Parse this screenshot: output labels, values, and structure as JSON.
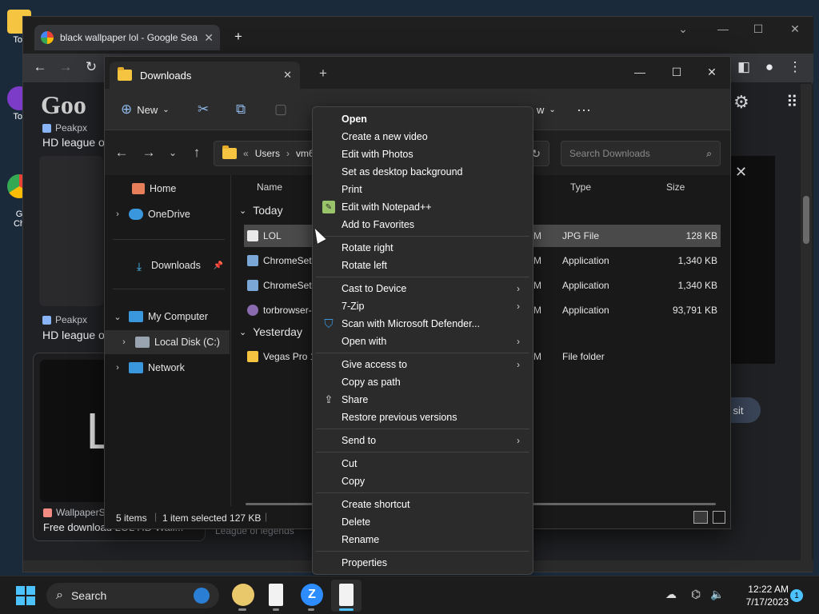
{
  "desktop": {
    "icons": [
      {
        "label": "Tor"
      },
      {
        "label": "Tor"
      },
      {
        "label": "G\nCh"
      }
    ]
  },
  "chrome": {
    "tab_title": "black wallpaper lol - Google Sear",
    "results": [
      {
        "source": "Peakpx",
        "title": "HD league o"
      },
      {
        "source": "Peakpx",
        "title": "HD league o"
      },
      {
        "source": "WallpaperS",
        "title": "Free download LOL HD Wall..."
      },
      {
        "source": "",
        "title": "League of legends"
      }
    ],
    "thumb_text": "LO",
    "visit_btn": "sit"
  },
  "explorer": {
    "tab_title": "Downloads",
    "commands": {
      "new_label": "New",
      "view_label": "w"
    },
    "address": {
      "prefix": "«",
      "parts": [
        "Users",
        "vm6"
      ]
    },
    "search": {
      "placeholder": "Search Downloads"
    },
    "nav": [
      {
        "label": "Home"
      },
      {
        "label": "OneDrive"
      },
      {
        "label": "Downloads"
      },
      {
        "label": "My Computer"
      },
      {
        "label": "Local Disk (C:)"
      },
      {
        "label": "Network"
      }
    ],
    "columns": {
      "name": "Name",
      "type": "Type",
      "size": "Size"
    },
    "groups": {
      "today": "Today",
      "yesterday": "Yesterday"
    },
    "files": [
      {
        "name": "LOL",
        "type": "JPG File",
        "size": "128 KB",
        "date_frag": "M"
      },
      {
        "name": "ChromeSetu",
        "type": "Application",
        "size": "1,340 KB",
        "date_frag": "M"
      },
      {
        "name": "ChromeSetu",
        "type": "Application",
        "size": "1,340 KB",
        "date_frag": "M"
      },
      {
        "name": "torbrowser-",
        "type": "Application",
        "size": "93,791 KB",
        "date_frag": "M"
      },
      {
        "name": "Vegas Pro 1:",
        "type": "File folder",
        "size": "",
        "date_frag": "M"
      }
    ],
    "status": {
      "count": "5 items",
      "selected": "1 item selected 127 KB"
    }
  },
  "context_menu": {
    "items": [
      {
        "label": "Open",
        "bold": true
      },
      {
        "label": "Create a new video"
      },
      {
        "label": "Edit with Photos"
      },
      {
        "label": "Set as desktop background"
      },
      {
        "label": "Print"
      },
      {
        "label": "Edit with Notepad++"
      },
      {
        "label": "Add to Favorites"
      },
      {
        "label": "Rotate right"
      },
      {
        "label": "Rotate left"
      },
      {
        "label": "Cast to Device"
      },
      {
        "label": "7-Zip"
      },
      {
        "label": "Scan with Microsoft Defender..."
      },
      {
        "label": "Open with"
      },
      {
        "label": "Give access to"
      },
      {
        "label": "Copy as path"
      },
      {
        "label": "Share"
      },
      {
        "label": "Restore previous versions"
      },
      {
        "label": "Send to"
      },
      {
        "label": "Cut"
      },
      {
        "label": "Copy"
      },
      {
        "label": "Create shortcut"
      },
      {
        "label": "Delete"
      },
      {
        "label": "Rename"
      },
      {
        "label": "Properties"
      }
    ]
  },
  "taskbar": {
    "search_label": "Search",
    "time": "12:22 AM",
    "date": "7/17/2023",
    "notification_count": "1"
  }
}
